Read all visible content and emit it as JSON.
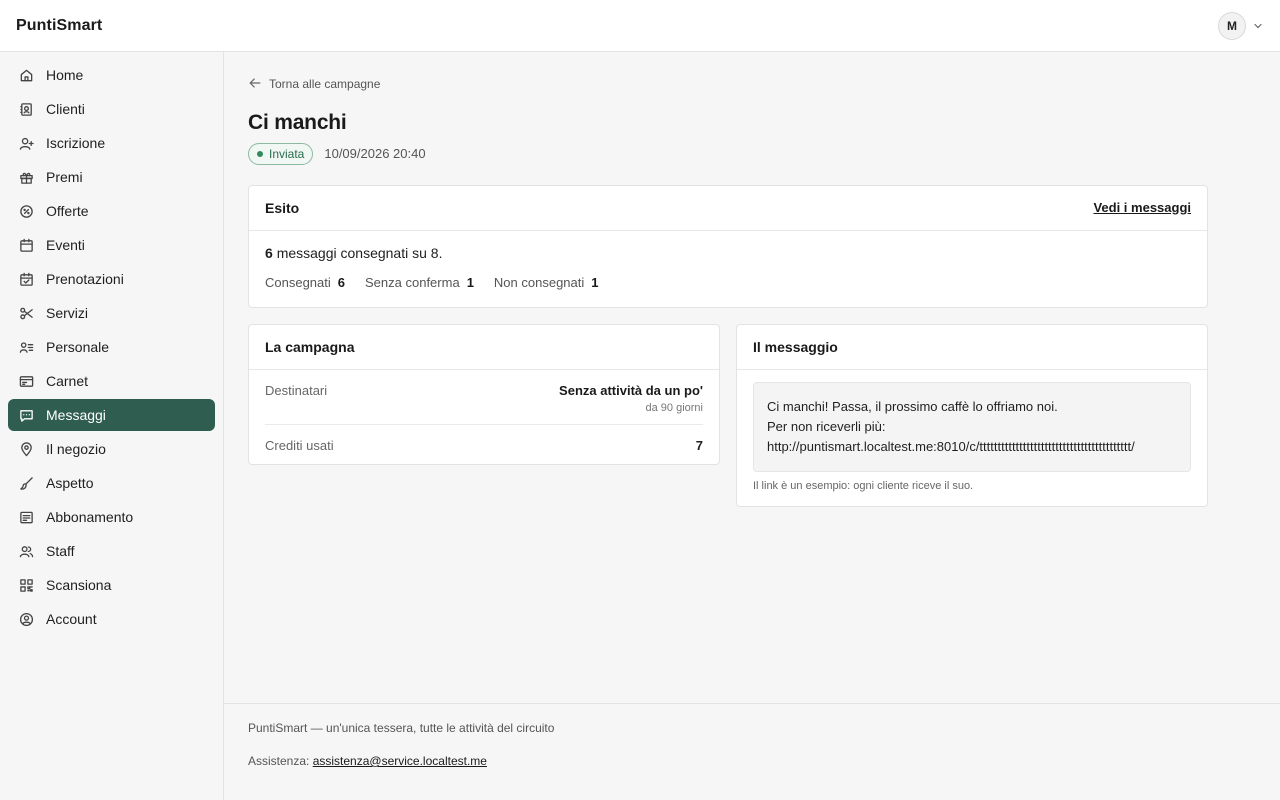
{
  "app": {
    "brand": "PuntiSmart",
    "user_initial": "M"
  },
  "sidebar": {
    "items": [
      {
        "label": "Home",
        "icon": "home-icon"
      },
      {
        "label": "Clienti",
        "icon": "contacts-icon"
      },
      {
        "label": "Iscrizione",
        "icon": "user-plus-icon"
      },
      {
        "label": "Premi",
        "icon": "gift-icon"
      },
      {
        "label": "Offerte",
        "icon": "badge-percent-icon"
      },
      {
        "label": "Eventi",
        "icon": "calendar-icon"
      },
      {
        "label": "Prenotazioni",
        "icon": "calendar-check-icon"
      },
      {
        "label": "Servizi",
        "icon": "scissors-icon"
      },
      {
        "label": "Personale",
        "icon": "user-list-icon"
      },
      {
        "label": "Carnet",
        "icon": "ticket-icon"
      },
      {
        "label": "Messaggi",
        "icon": "message-icon",
        "active": true
      },
      {
        "label": "Il negozio",
        "icon": "map-pin-icon"
      },
      {
        "label": "Aspetto",
        "icon": "brush-icon"
      },
      {
        "label": "Abbonamento",
        "icon": "receipt-icon"
      },
      {
        "label": "Staff",
        "icon": "users-icon"
      },
      {
        "label": "Scansiona",
        "icon": "qr-code-icon"
      },
      {
        "label": "Account",
        "icon": "user-circle-icon"
      }
    ]
  },
  "main": {
    "back_label": "Torna alle campagne",
    "title": "Ci manchi",
    "status": "Inviata",
    "date": "10/09/2026 20:40",
    "esito": {
      "title": "Esito",
      "link": "Vedi i messaggi",
      "delivered": "6",
      "summary_rest": "messaggi consegnati su 8.",
      "stats": [
        {
          "label": "Consegnati",
          "value": "6"
        },
        {
          "label": "Senza conferma",
          "value": "1"
        },
        {
          "label": "Non consegnati",
          "value": "1"
        }
      ]
    },
    "campagna": {
      "title": "La campagna",
      "recipients_label": "Destinatari",
      "recipients_value": "Senza attività da un po'",
      "recipients_sub": "da 90 giorni",
      "credits_label": "Crediti usati",
      "credits_value": "7"
    },
    "messaggio": {
      "title": "Il messaggio",
      "line1": "Ci manchi! Passa, il prossimo caffè lo offriamo noi.",
      "line2": "Per non riceverli più:",
      "line3": "http://puntismart.localtest.me:8010/c/tttttttttttttttttttttttttttttttttttttttttt/",
      "hint": "Il link è un esempio: ogni cliente riceve il suo."
    }
  },
  "footer": {
    "tagline": "PuntiSmart — un'unica tessera, tutte le attività del circuito",
    "support_label": "Assistenza:",
    "support_email": "assistenza@service.localtest.me"
  }
}
